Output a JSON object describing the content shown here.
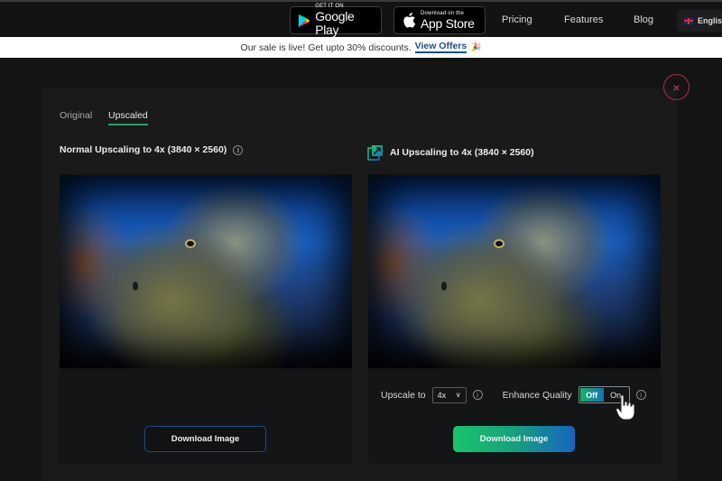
{
  "header": {
    "google_play": {
      "small": "GET IT ON",
      "big": "Google Play"
    },
    "app_store": {
      "small": "Download on the",
      "big": "App Store"
    },
    "nav": [
      "Pricing",
      "Features",
      "Blog"
    ],
    "language": "English"
  },
  "banner": {
    "text": "Our sale is live! Get upto 30% discounts.",
    "link": "View Offers",
    "emoji": "🎉"
  },
  "modal": {
    "close_icon": "×",
    "tabs": [
      {
        "label": "Original",
        "active": false
      },
      {
        "label": "Upscaled",
        "active": true
      }
    ],
    "left": {
      "title": "Normal Upscaling to 4x (3840 × 2560)",
      "info": "i",
      "download_label": "Download Image"
    },
    "right": {
      "title": "AI Upscaling to 4x (3840 × 2560)",
      "upscale_label": "Upscale to",
      "upscale_value": "4x",
      "enhance_label": "Enhance Quality",
      "toggle_off": "Off",
      "toggle_on": "On",
      "toggle_state": "Off",
      "info": "i",
      "download_label": "Download Image"
    }
  },
  "colors": {
    "accent_green": "#1fa36a",
    "gradient_start": "#19c46c",
    "gradient_end": "#1565c0",
    "close_red": "#b02a44",
    "link_blue": "#1b4f8a"
  }
}
